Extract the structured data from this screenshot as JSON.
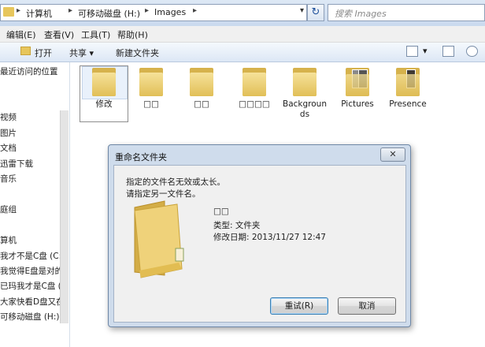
{
  "address": {
    "crumbs": [
      "计算机",
      "可移动磁盘 (H:)",
      "Images"
    ],
    "search_placeholder": "搜索 Images"
  },
  "menu": [
    "编辑(E)",
    "查看(V)",
    "工具(T)",
    "帮助(H)"
  ],
  "toolbar": {
    "open": "打开",
    "share": "共享 ▾",
    "new_folder": "新建文件夹"
  },
  "nav": {
    "items": [
      "最近访问的位置",
      "视频",
      "图片",
      "文档",
      "迅雷下载",
      "音乐",
      "庭组",
      "算机",
      "我才不是C盘 (C:)",
      "我觉得E盘是对的",
      "已玛我才是C盘 (",
      "大家快看D盘又在",
      "可移动磁盘 (H:)"
    ]
  },
  "files": [
    {
      "label": "修改",
      "type": "folder"
    },
    {
      "label": "□□",
      "type": "folder"
    },
    {
      "label": "□□",
      "type": "folder"
    },
    {
      "label": "□□□□",
      "type": "folder"
    },
    {
      "label": "Backgrounds",
      "type": "folder"
    },
    {
      "label": "Pictures",
      "type": "folder-with-pictures"
    },
    {
      "label": "Presence",
      "type": "folder-with-pictures"
    }
  ],
  "dialog": {
    "title": "重命名文件夹",
    "close": "✕",
    "message_line1": "指定的文件名无效或太长。",
    "message_line2": "请指定另一文件名。",
    "item_name": "□□",
    "item_type": "类型: 文件夹",
    "item_modified": "修改日期: 2013/11/27 12:47",
    "retry_label": "重试(R)",
    "cancel_label": "取消"
  },
  "colors": {
    "accent": "#1d4f9a",
    "folder": "#e7c65c"
  }
}
